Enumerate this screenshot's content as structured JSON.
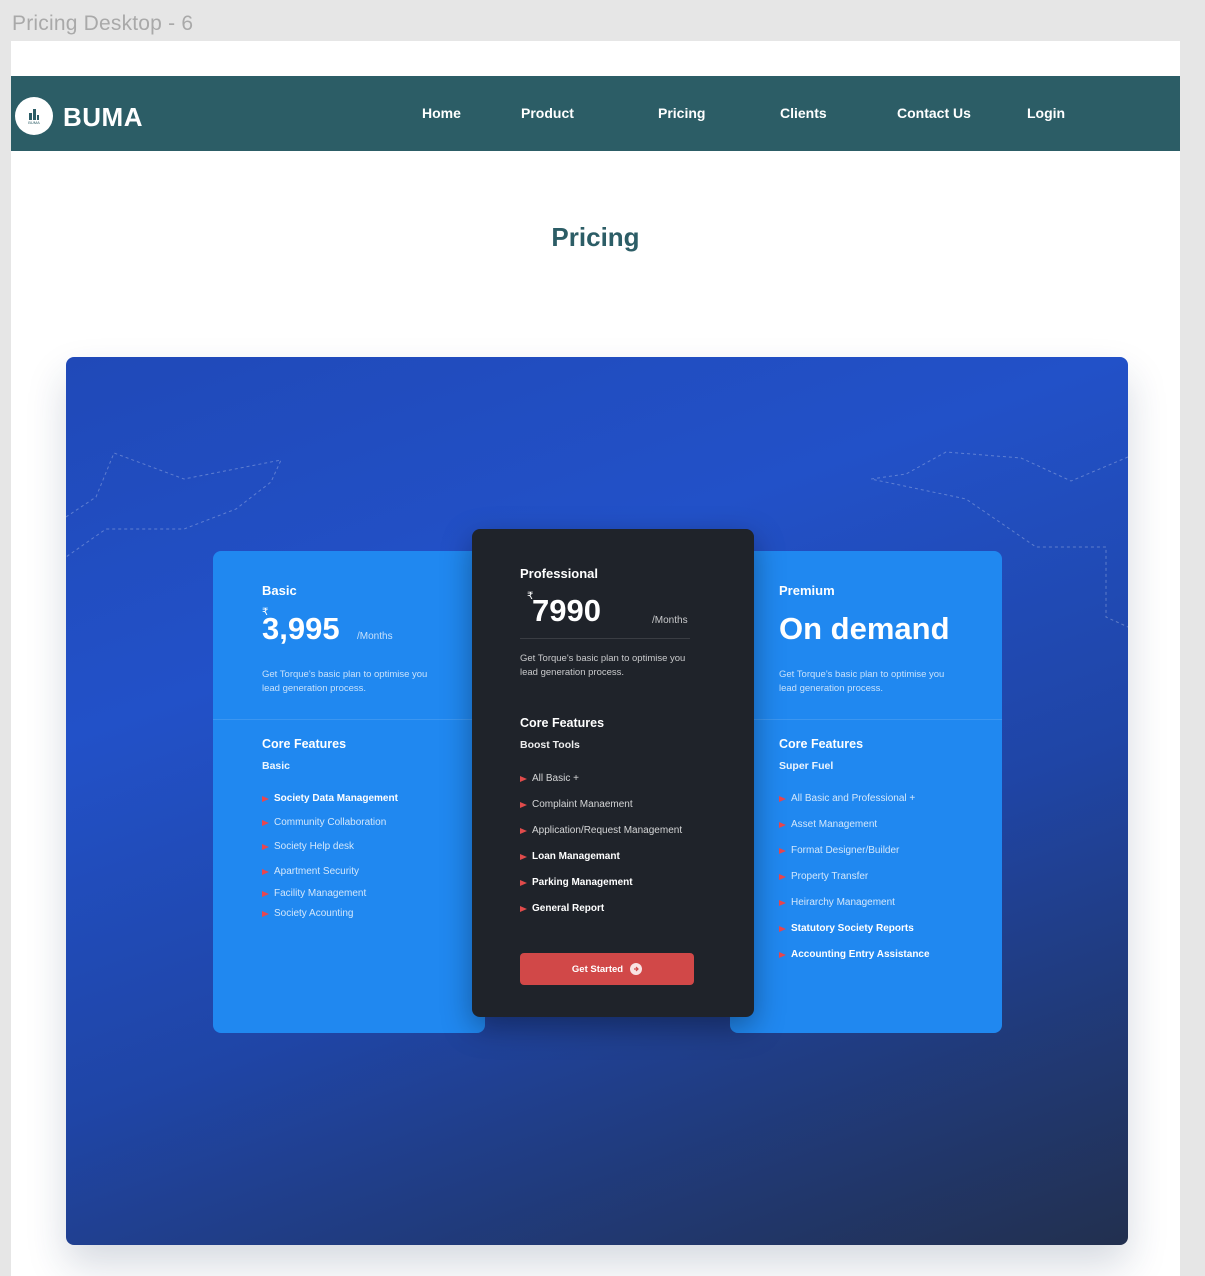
{
  "frame_label": "Pricing Desktop - 6",
  "logo": {
    "tiny_text": "BUMA"
  },
  "brand": "BUMA",
  "nav": {
    "items": [
      {
        "label": "Home"
      },
      {
        "label": "Product"
      },
      {
        "label": "Pricing"
      },
      {
        "label": "Clients"
      },
      {
        "label": "Contact Us"
      },
      {
        "label": "Login"
      }
    ]
  },
  "page_title": "Pricing",
  "plans": {
    "basic": {
      "name": "Basic",
      "currency": "₹",
      "price": "3,995",
      "period": "/Months",
      "description": "Get Torque's basic plan to optimise you lead generation process.",
      "section": "Core Features",
      "sub": "Basic",
      "features": [
        {
          "label": "Society Data Management"
        },
        {
          "label": "Community Collaboration"
        },
        {
          "label": "Society Help desk"
        },
        {
          "label": "Apartment Security"
        },
        {
          "label": "Facility Management"
        },
        {
          "label": "Society  Acounting"
        }
      ]
    },
    "professional": {
      "name": "Professional",
      "currency": "₹",
      "price": "7990",
      "period": "/Months",
      "description": "Get Torque's basic plan to optimise you lead generation process.",
      "section": "Core Features",
      "sub": "Boost Tools",
      "features": [
        {
          "label": "All Basic +"
        },
        {
          "label": "Complaint Manaement"
        },
        {
          "label": "Application/Request Management"
        },
        {
          "label": "Loan Managemant"
        },
        {
          "label": "Parking Management"
        },
        {
          "label": "General Report"
        }
      ],
      "cta_label": "Get Started"
    },
    "premium": {
      "name": "Premium",
      "price": "On demand",
      "description": "Get Torque's basic plan to optimise you lead generation process.",
      "section": "Core Features",
      "sub": "Super Fuel",
      "features": [
        {
          "label": "All Basic and Professional +"
        },
        {
          "label": "Asset Management"
        },
        {
          "label": "Format Designer/Builder"
        },
        {
          "label": "Property Transfer"
        },
        {
          "label": "Heirarchy Management"
        },
        {
          "label": "Statutory Society Reports"
        },
        {
          "label": "Accounting Entry Assistance"
        }
      ]
    }
  },
  "colors": {
    "nav_bg": "#2c5d66",
    "panel_blue": "#2251c8",
    "card_blue": "#2088f0",
    "card_dark": "#1f232a",
    "cta_red": "#d14848"
  }
}
